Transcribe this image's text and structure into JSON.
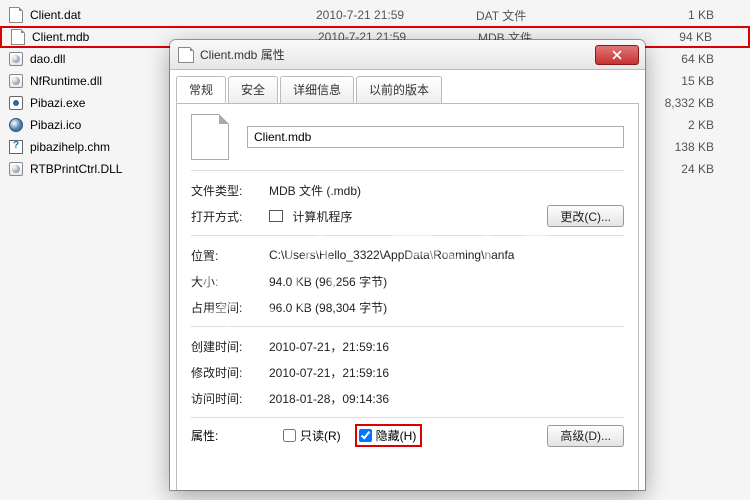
{
  "file_list": [
    {
      "name": "Client.dat",
      "date": "2010-7-21 21:59",
      "type": "DAT 文件",
      "size": "1 KB",
      "icon": "generic",
      "highlighted": false
    },
    {
      "name": "Client.mdb",
      "date": "2010-7-21 21:59",
      "type": "MDB 文件",
      "size": "94 KB",
      "icon": "generic",
      "highlighted": true
    },
    {
      "name": "dao.dll",
      "date": "",
      "type": "",
      "size": "64 KB",
      "icon": "dll",
      "highlighted": false
    },
    {
      "name": "NfRuntime.dll",
      "date": "",
      "type": "",
      "size": "15 KB",
      "icon": "dll",
      "highlighted": false
    },
    {
      "name": "Pibazi.exe",
      "date": "",
      "type": "",
      "size": "8,332 KB",
      "icon": "exe",
      "highlighted": false
    },
    {
      "name": "Pibazi.ico",
      "date": "",
      "type": "",
      "size": "2 KB",
      "icon": "ico",
      "highlighted": false
    },
    {
      "name": "pibazihelp.chm",
      "date": "",
      "type": "",
      "size": "138 KB",
      "icon": "chm",
      "highlighted": false
    },
    {
      "name": "RTBPrintCtrl.DLL",
      "date": "",
      "type": "",
      "size": "24 KB",
      "icon": "dll",
      "highlighted": false
    }
  ],
  "dialog": {
    "title": "Client.mdb 属性",
    "tabs": {
      "general": "常规",
      "security": "安全",
      "details": "详细信息",
      "previous": "以前的版本"
    },
    "filename": "Client.mdb",
    "rows": {
      "file_type": {
        "label": "文件类型:",
        "value": "MDB 文件 (.mdb)"
      },
      "open_with": {
        "label": "打开方式:",
        "value": "计算机程序",
        "button": "更改(C)..."
      },
      "location": {
        "label": "位置:",
        "value": "C:\\Users\\Hello_3322\\AppData\\Roaming\\nanfa"
      },
      "size": {
        "label": "大小:",
        "value": "94.0 KB (96,256 字节)"
      },
      "size_ondisk": {
        "label": "占用空间:",
        "value": "96.0 KB (98,304 字节)"
      },
      "created": {
        "label": "创建时间:",
        "value": "2010-07-21，21:59:16"
      },
      "modified": {
        "label": "修改时间:",
        "value": "2010-07-21，21:59:16"
      },
      "accessed": {
        "label": "访问时间:",
        "value": "2018-01-28，09:14:36"
      },
      "attributes": {
        "label": "属性:",
        "readonly_label": "只读(R)",
        "hidden_label": "隐藏(H)",
        "advanced_button": "高级(D)..."
      }
    }
  },
  "watermark": "软件 宝库"
}
